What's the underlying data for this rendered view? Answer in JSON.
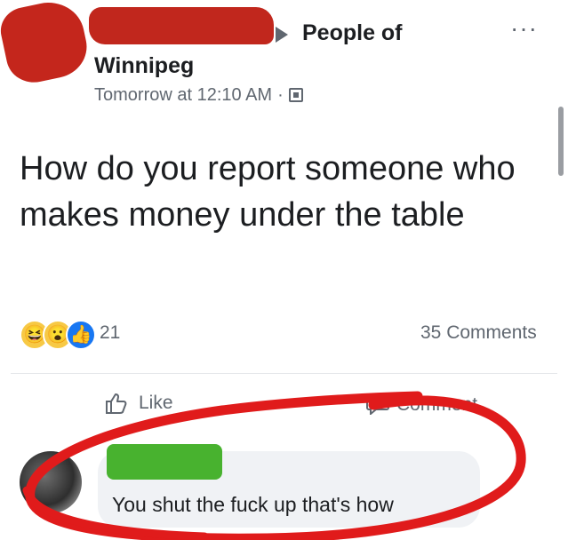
{
  "post": {
    "group_line1": "People of",
    "group_line2": "Winnipeg",
    "time": "Tomorrow at 12:10 AM",
    "dot": "·",
    "more": "···",
    "text": "How do you report someone who makes money under the table"
  },
  "stats": {
    "reaction_count": "21",
    "comments": "35 Comments",
    "reaction_icons": [
      "haha-icon",
      "wow-icon",
      "like-icon"
    ]
  },
  "actions": {
    "like_label": "Like",
    "comment_label": "Comment"
  },
  "comment": {
    "text": "You shut the fuck up that's how"
  },
  "colors": {
    "redaction_red": "#c1271d",
    "redaction_green": "#48b22f",
    "marker_red": "#e01b1b",
    "facebook_blue": "#1877f2",
    "meta_gray": "#606770"
  }
}
